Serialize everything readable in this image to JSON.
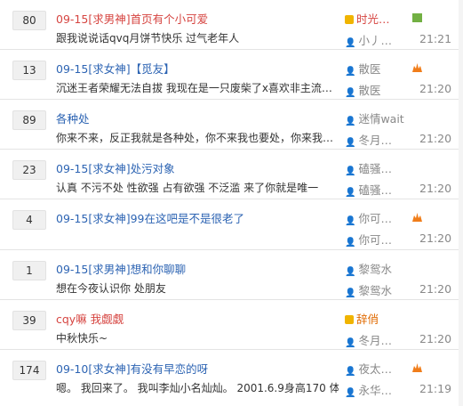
{
  "threads": [
    {
      "count": "80",
      "title": "09-15[求男神]首页有个小可爱",
      "title_color": "red",
      "excerpt": "跟我说说话qvq月饼节快乐 过气老年人",
      "author": "时光…",
      "author_style": "vip-r",
      "last_reply": "小丿…",
      "time": "21:21",
      "level": "green"
    },
    {
      "count": "13",
      "title": "09-15[求女神]【觅友】",
      "title_color": "blue",
      "excerpt": "沉迷王者荣耀无法自拔 我现在是一只废柴了x喜欢非主流…",
      "author": "散医",
      "author_style": "normal",
      "last_reply": "散医",
      "time": "21:20",
      "level": "orange"
    },
    {
      "count": "89",
      "title": "各种处",
      "title_color": "blue",
      "excerpt": "你来不来，反正我就是各种处，你不来我也要处，你来我…",
      "author": "迷情wait",
      "author_style": "normal",
      "last_reply": "冬月…",
      "time": "21:20",
      "level": ""
    },
    {
      "count": "23",
      "title": "09-15[求女神]处污对象",
      "title_color": "blue",
      "excerpt": "认真 不污不处 性欲强 占有欲强 不泛滥 来了你就是唯一",
      "author": "磕骚…",
      "author_style": "normal",
      "last_reply": "磕骚…",
      "time": "21:20",
      "level": ""
    },
    {
      "count": "4",
      "title": "09-15[求女神]99在这吧是不是很老了",
      "title_color": "blue",
      "excerpt": "",
      "author": "你可…",
      "author_style": "normal",
      "last_reply": "你可…",
      "time": "21:20",
      "level": "orange"
    },
    {
      "count": "1",
      "title": "09-15[求男神]想和你聊聊",
      "title_color": "blue",
      "excerpt": "想在今夜认识你 处朋友",
      "author": "黎鸳水",
      "author_style": "normal",
      "last_reply": "黎鸳水",
      "time": "21:20",
      "level": ""
    },
    {
      "count": "39",
      "title": "cqy嘛 我觑觑",
      "title_color": "red",
      "excerpt": "中秋快乐~",
      "author": "辞俏",
      "author_style": "vip",
      "last_reply": "冬月…",
      "time": "21:20",
      "level": ""
    },
    {
      "count": "174",
      "title": "09-10[求女神]有没有早恋的呀",
      "title_color": "blue",
      "excerpt": "嗯。 我回来了。 我叫李灿小名灿灿。 2001.6.9身高170 体…",
      "author": "夜太…",
      "author_style": "normal",
      "last_reply": "永华…",
      "time": "21:19",
      "level": "orange"
    }
  ],
  "colors": {
    "link": "#2d64b3",
    "red": "#d64541",
    "muted": "#888888",
    "level_green": "#72b043",
    "level_orange": "#f07d1a"
  }
}
